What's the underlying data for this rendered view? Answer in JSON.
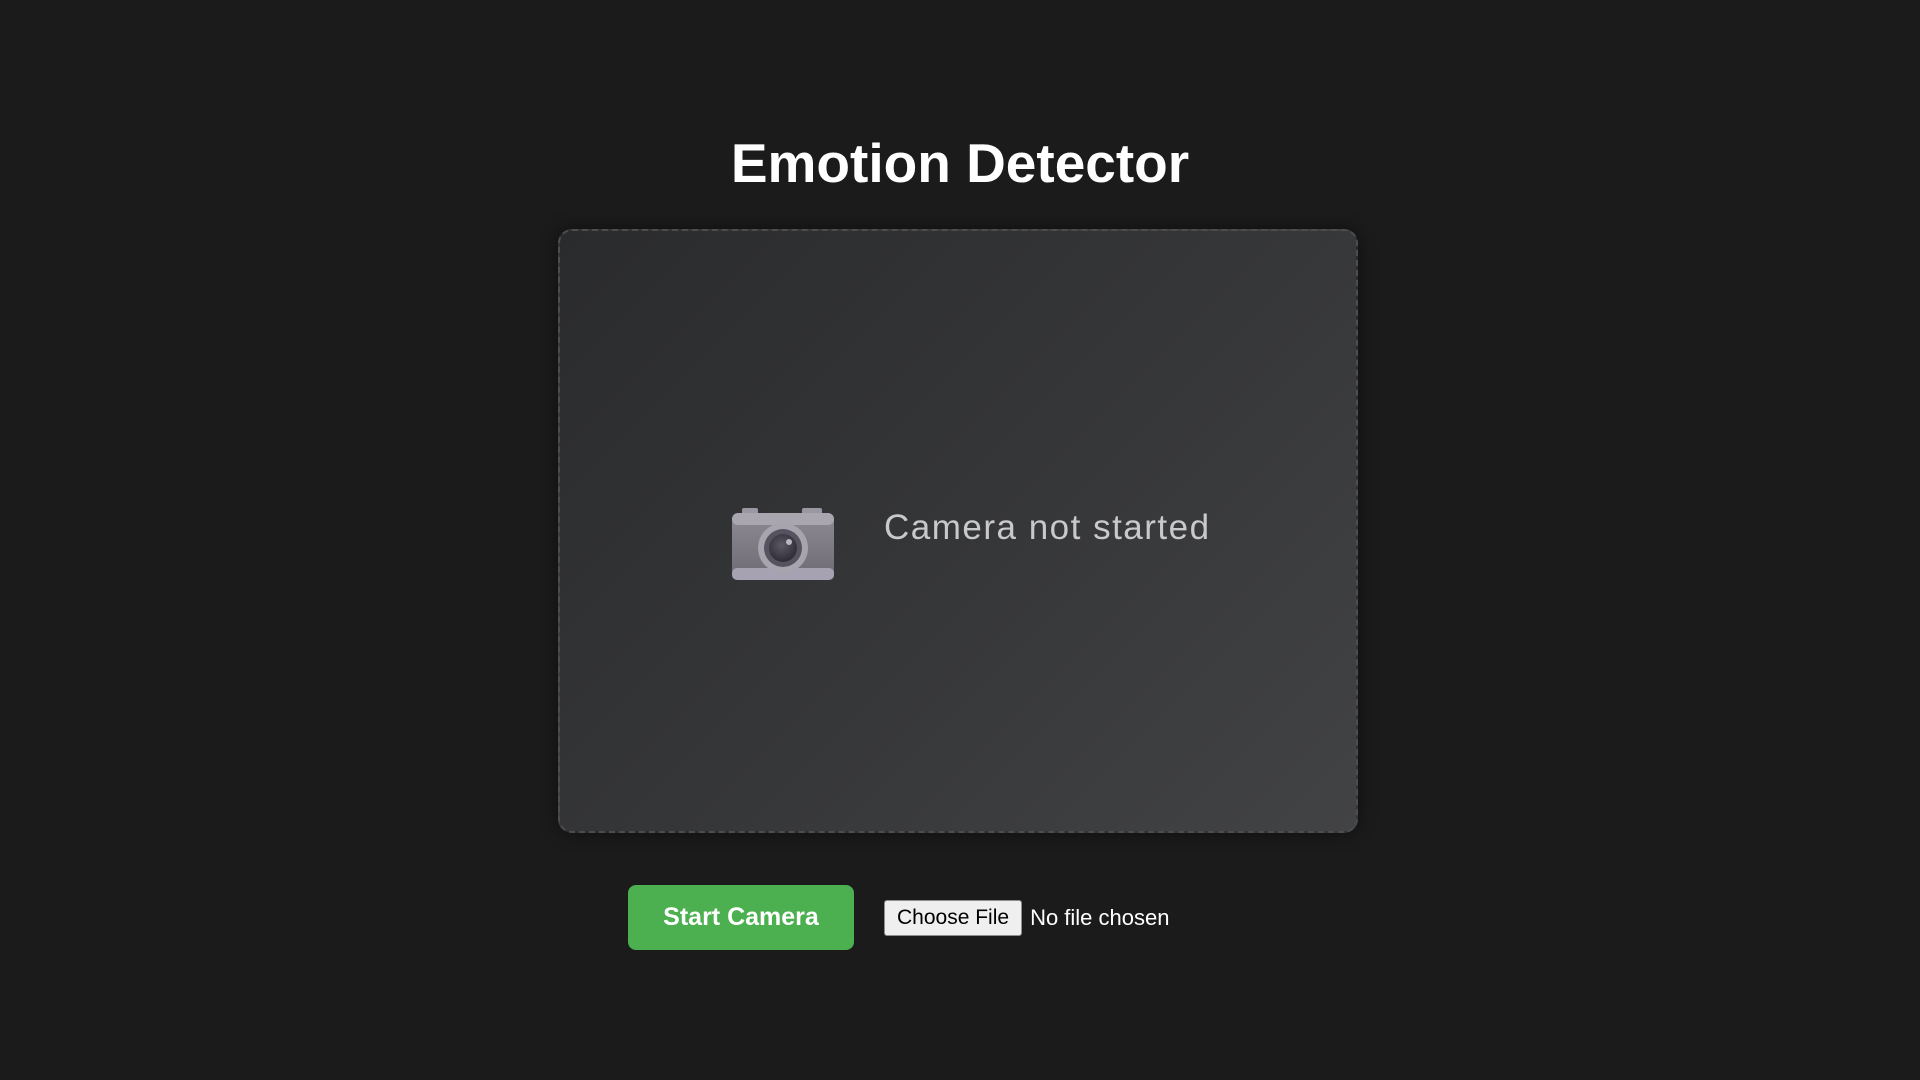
{
  "page": {
    "title": "Emotion Detector"
  },
  "camera_panel": {
    "icon": "camera-icon",
    "status_text": "Camera not started"
  },
  "controls": {
    "start_camera_label": "Start Camera",
    "choose_file_label": "Choose File",
    "file_status": "No file chosen"
  },
  "colors": {
    "background": "#1b1b1b",
    "accent_button": "#4caf50",
    "panel": "#353638",
    "status_text": "#c9c9c9"
  }
}
